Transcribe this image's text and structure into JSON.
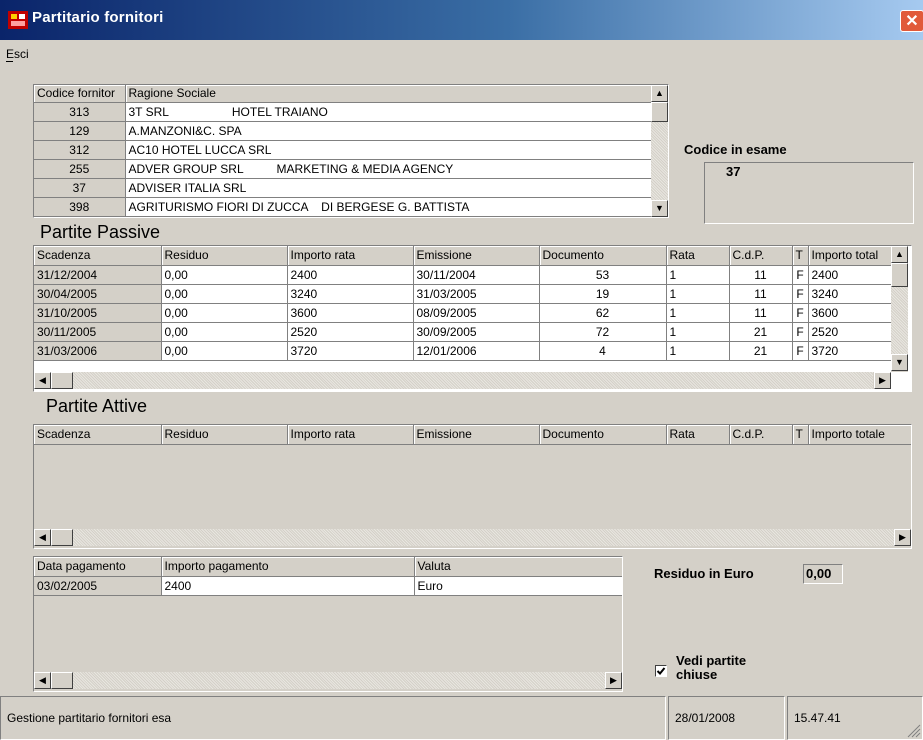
{
  "window": {
    "title": "Partitario fornitori",
    "close_label": "✕"
  },
  "menu": {
    "esci": "Esci"
  },
  "suppliers": {
    "headers": [
      "Codice fornitor",
      "Ragione Sociale"
    ],
    "rows": [
      {
        "code": "313",
        "name": "3T SRL                   HOTEL TRAIANO"
      },
      {
        "code": "129",
        "name": "A.MANZONI&C. SPA"
      },
      {
        "code": "312",
        "name": "AC10 HOTEL LUCCA SRL"
      },
      {
        "code": "255",
        "name": "ADVER GROUP SRL          MARKETING & MEDIA AGENCY"
      },
      {
        "code": "37",
        "name": "ADVISER ITALIA SRL"
      },
      {
        "code": "398",
        "name": "AGRITURISMO FIORI DI ZUCCA    DI BERGESE G. BATTISTA"
      }
    ]
  },
  "codice_in_esame": {
    "label": "Codice in esame",
    "value": "37"
  },
  "passive": {
    "title": "Partite Passive",
    "headers": [
      "Scadenza",
      "Residuo",
      "Importo rata",
      "Emissione",
      "Documento",
      "Rata",
      "C.d.P.",
      "T",
      "Importo total"
    ],
    "rows": [
      [
        "31/12/2004",
        "0,00",
        "2400",
        "30/11/2004",
        "53",
        "1",
        "11",
        "F",
        "2400"
      ],
      [
        "30/04/2005",
        "0,00",
        "3240",
        "31/03/2005",
        "19",
        "1",
        "11",
        "F",
        "3240"
      ],
      [
        "31/10/2005",
        "0,00",
        "3600",
        "08/09/2005",
        "62",
        "1",
        "11",
        "F",
        "3600"
      ],
      [
        "30/11/2005",
        "0,00",
        "2520",
        "30/09/2005",
        "72",
        "1",
        "21",
        "F",
        "2520"
      ],
      [
        "31/03/2006",
        "0,00",
        "3720",
        "12/01/2006",
        "4",
        "1",
        "21",
        "F",
        "3720"
      ]
    ]
  },
  "attive": {
    "title": "Partite Attive",
    "headers": [
      "Scadenza",
      "Residuo",
      "Importo rata",
      "Emissione",
      "Documento",
      "Rata",
      "C.d.P.",
      "T",
      "Importo totale"
    ]
  },
  "payments": {
    "headers": [
      "Data pagamento",
      "Importo pagamento",
      "Valuta"
    ],
    "rows": [
      [
        "03/02/2005",
        "2400",
        "Euro"
      ]
    ]
  },
  "residuo": {
    "label": "Residuo in Euro",
    "value": "0,00"
  },
  "vedi": {
    "label_line1": "Vedi partite",
    "label_line2": "chiuse",
    "checked": true
  },
  "status": {
    "message": "Gestione partitario fornitori  esa",
    "date": "28/01/2008",
    "time": "15.47.41"
  }
}
